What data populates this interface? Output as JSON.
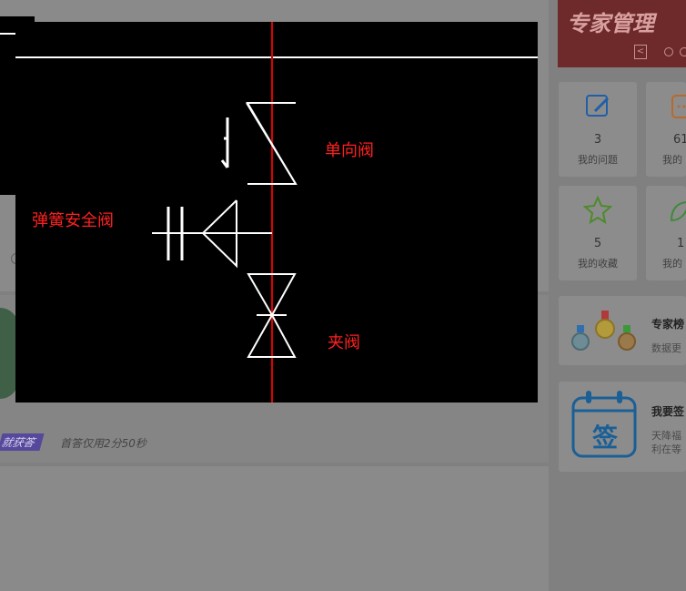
{
  "left": {
    "badge": "就获答",
    "first_answer": "首答仅用2分50秒"
  },
  "sidebar": {
    "banner_title": "专家管理",
    "banner_prev": "<",
    "stats": [
      {
        "count": "3",
        "label": "我的问题",
        "icon": "edit-icon"
      },
      {
        "count": "61",
        "label": "我的",
        "icon": "message-icon"
      },
      {
        "count": "5",
        "label": "我的收藏",
        "icon": "star-icon"
      },
      {
        "count": "1",
        "label": "我的",
        "icon": "leaf-icon"
      }
    ],
    "ranking": {
      "title": "专家榜",
      "subtitle": "数据更"
    },
    "checkin": {
      "title": "我要签",
      "icon_text": "签",
      "line1": "天降福",
      "line2": "利在等"
    }
  },
  "cad": {
    "check_valve": "单向阀",
    "safety_valve": "弹簧安全阀",
    "pinch_valve": "夹阀"
  },
  "colors": {
    "pipe": "#e00000",
    "label": "#ff2020",
    "line": "#ffffff",
    "banner": "#6e2a2a"
  }
}
